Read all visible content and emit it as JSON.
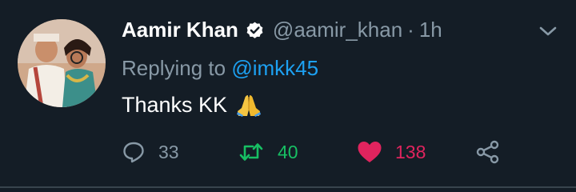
{
  "tweet": {
    "author_name": "Aamir Khan",
    "handle": "@aamir_khan",
    "separator": "·",
    "time": "1h",
    "replying_prefix": "Replying to",
    "replying_mention": "@imkk45",
    "text": "Thanks KK",
    "emoji_icon": "folded-hands-icon",
    "verified_icon": "verified-badge-icon",
    "menu_icon": "chevron-down-icon"
  },
  "actions": {
    "reply": {
      "icon": "reply-bubble-icon",
      "count": "33"
    },
    "retweet": {
      "icon": "retweet-icon",
      "count": "40"
    },
    "like": {
      "icon": "heart-icon",
      "count": "138"
    },
    "share": {
      "icon": "share-icon"
    }
  },
  "colors": {
    "background": "#141d26",
    "primary_text": "#ffffff",
    "secondary_text": "#8899a6",
    "link": "#1da1f2",
    "retweet": "#17bf63",
    "like": "#e0245e"
  }
}
